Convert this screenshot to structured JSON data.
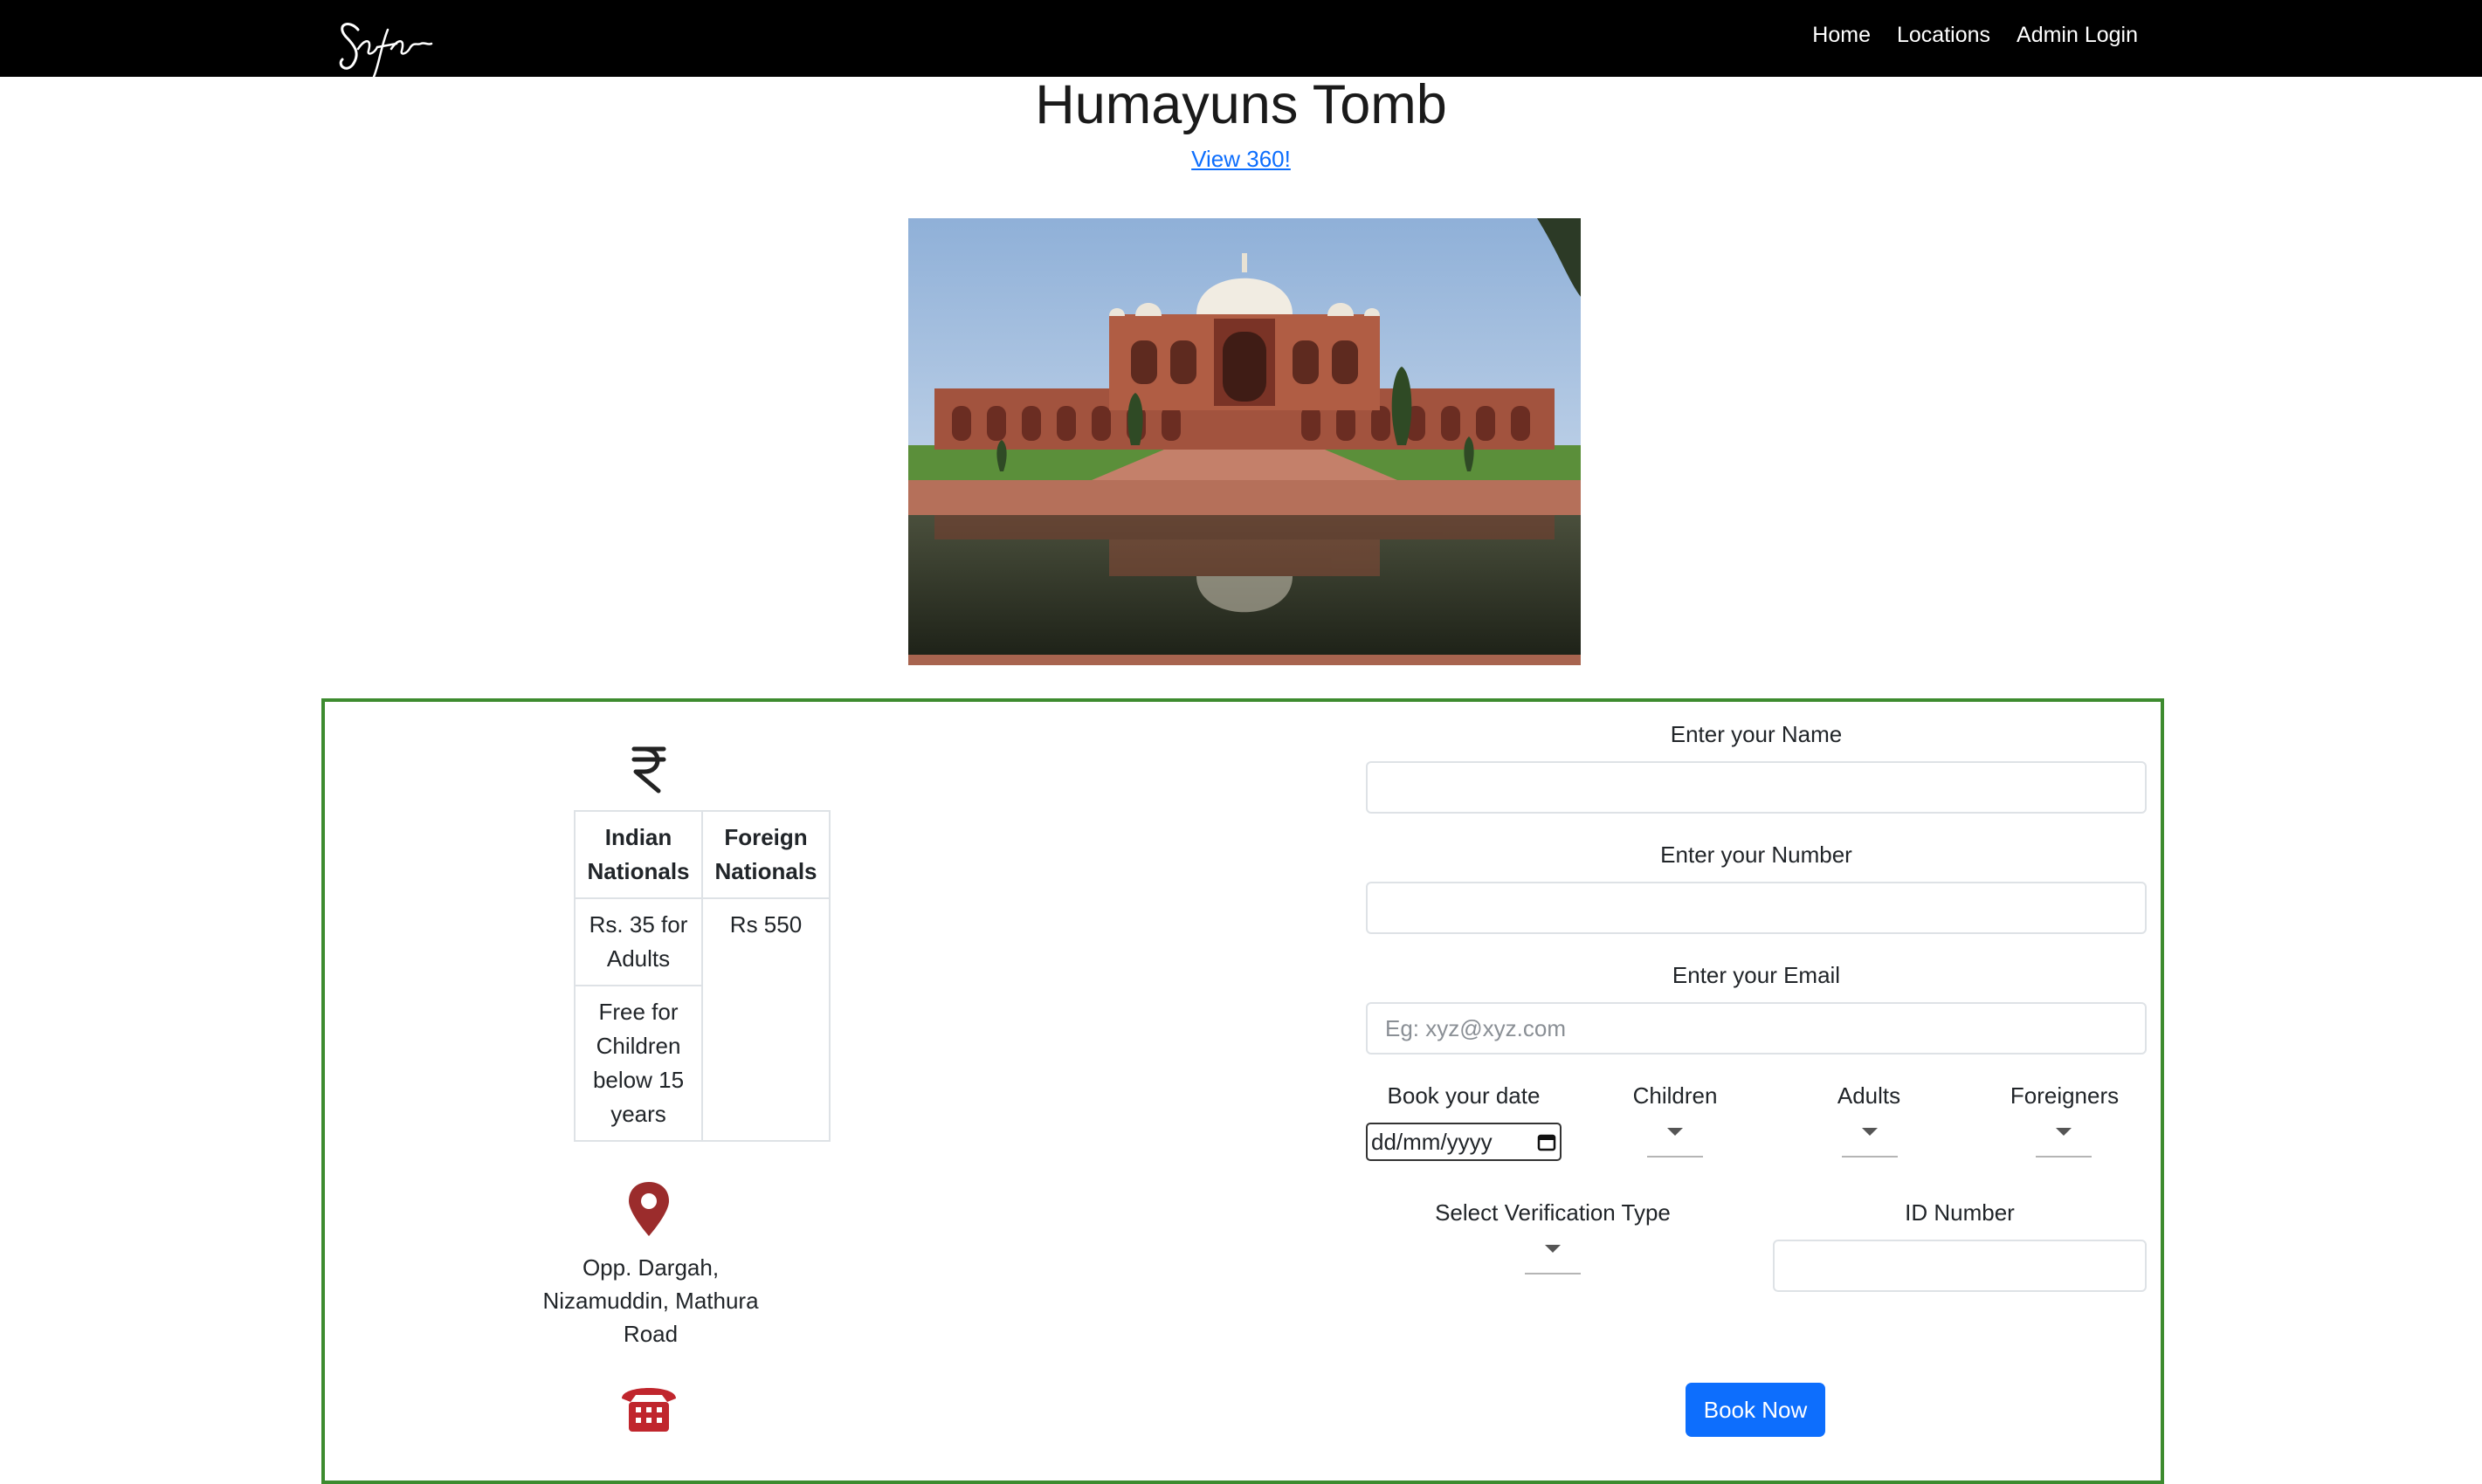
{
  "nav": {
    "brand": "Safar",
    "links": [
      "Home",
      "Locations",
      "Admin Login"
    ]
  },
  "page": {
    "title": "Humayuns Tomb",
    "view_link": "View 360!"
  },
  "fees": {
    "headers": [
      "Indian Nationals",
      "Foreign Nationals"
    ],
    "indian": [
      "Rs. 35 for Adults",
      "Free for Children below 15 years"
    ],
    "foreign": "Rs 550"
  },
  "address": "Opp. Dargah, Nizamuddin, Mathura Road",
  "form": {
    "name_label": "Enter your Name",
    "number_label": "Enter your Number",
    "email_label": "Enter your Email",
    "email_placeholder": "Eg: xyz@xyz.com",
    "date_label": "Book your date",
    "date_placeholder": "dd/mm/yyyy",
    "children_label": "Children",
    "adults_label": "Adults",
    "foreigners_label": "Foreigners",
    "verification_label": "Select Verification Type",
    "id_label": "ID Number",
    "submit": "Book Now"
  },
  "colors": {
    "navbar": "#000000",
    "card_border": "#3d8b2f",
    "link": "#0d6efd",
    "button": "#0d6efd",
    "icon_red": "#9b2c2c"
  },
  "icons": [
    "rupee-icon",
    "location-pin-icon",
    "telephone-icon",
    "calendar-icon"
  ]
}
